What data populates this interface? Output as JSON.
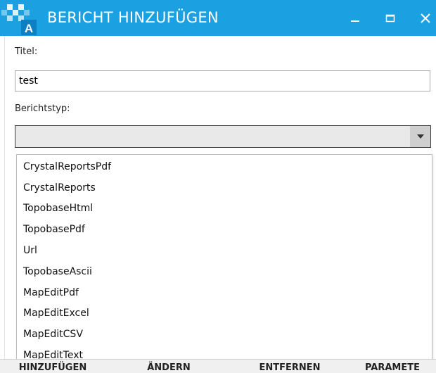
{
  "window": {
    "title": "BERICHT HINZUFÜGEN",
    "accent": "#1ba1e2"
  },
  "form": {
    "titel_label": "Titel:",
    "titel_value": "test",
    "berichtstyp_label": "Berichtstyp:",
    "berichtstyp_value": ""
  },
  "dropdown": {
    "options": [
      "CrystalReportsPdf",
      "CrystalReports",
      "TopobaseHtml",
      "TopobasePdf",
      "Url",
      "TopobaseAscii",
      "MapEditPdf",
      "MapEditExcel",
      "MapEditCSV",
      "MapEditText"
    ]
  },
  "bottom_buttons": [
    "HINZUFÜGEN",
    "ÄNDERN",
    "ENTFERNEN",
    "PARAMETE"
  ]
}
